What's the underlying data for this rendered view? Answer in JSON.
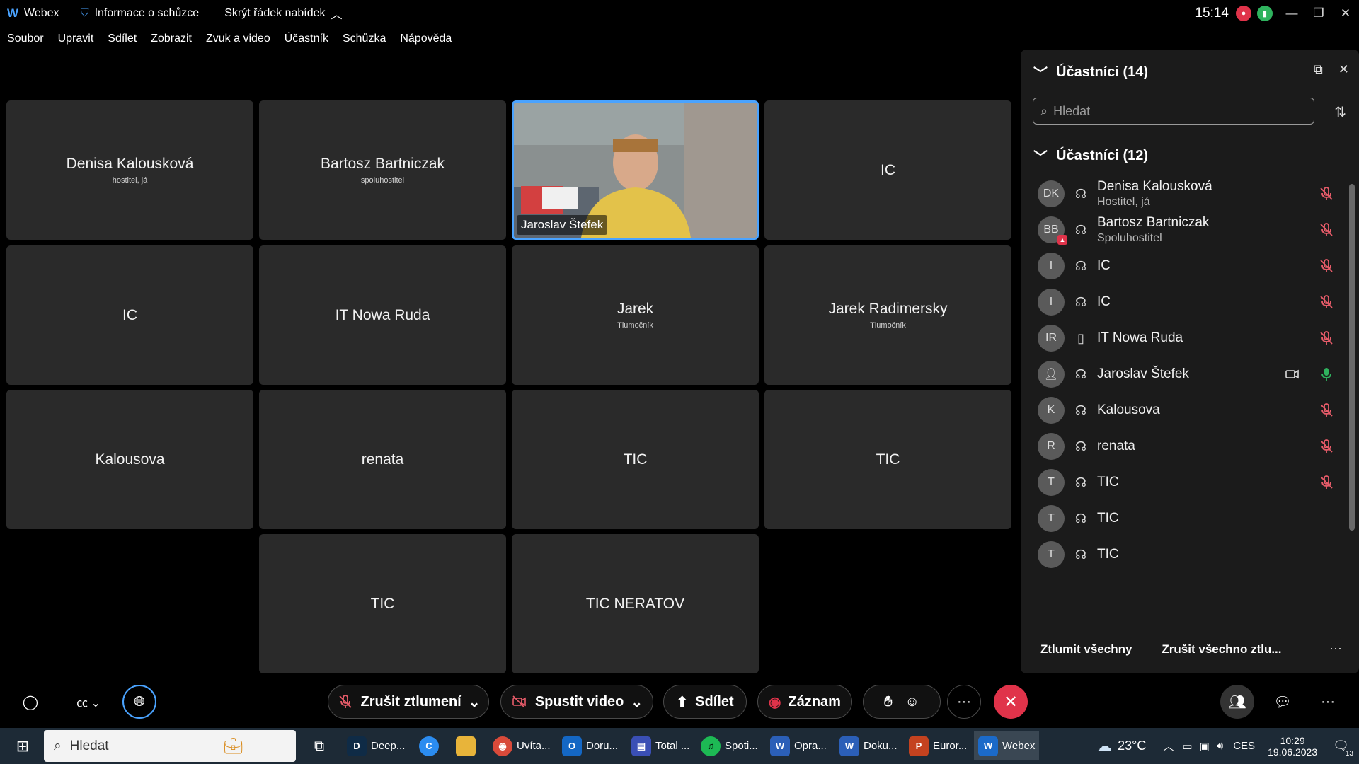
{
  "titlebar": {
    "app_name": "Webex",
    "meeting_info": "Informace o schůzce",
    "hide_menu": "Skrýt řádek nabídek",
    "time": "15:14"
  },
  "menu": [
    "Soubor",
    "Upravit",
    "Sdílet",
    "Zobrazit",
    "Zvuk a video",
    "Účastník",
    "Schůzka",
    "Nápověda"
  ],
  "tiles": [
    {
      "name": "Denisa Kalousková",
      "role": "hostitel, já"
    },
    {
      "name": "Bartosz Bartniczak",
      "role": "spoluhostitel"
    },
    {
      "name": "Jaroslav Štefek",
      "role": ""
    },
    {
      "name": "IC",
      "role": ""
    },
    {
      "name": "IC",
      "role": ""
    },
    {
      "name": "IT Nowa Ruda",
      "role": ""
    },
    {
      "name": "Jarek",
      "role": "Tlumočník"
    },
    {
      "name": "Jarek Radimersky",
      "role": "Tlumočník"
    },
    {
      "name": "Kalousova",
      "role": ""
    },
    {
      "name": "renata",
      "role": ""
    },
    {
      "name": "TIC",
      "role": ""
    },
    {
      "name": "TIC",
      "role": ""
    },
    {
      "name": "TIC",
      "role": ""
    },
    {
      "name": "TIC NERATOV",
      "role": ""
    }
  ],
  "panel": {
    "title": "Účastníci (14)",
    "search_placeholder": "Hledat",
    "section_title": "Účastníci (12)",
    "participants": [
      {
        "initials": "DK",
        "name": "Denisa Kalousková",
        "role": "Hostitel, já",
        "mic": "muted"
      },
      {
        "initials": "BB",
        "name": "Bartosz Bartniczak",
        "role": "Spoluhostitel",
        "mic": "muted"
      },
      {
        "initials": "I",
        "name": "IC",
        "role": "",
        "mic": "muted"
      },
      {
        "initials": "I",
        "name": "IC",
        "role": "",
        "mic": "muted"
      },
      {
        "initials": "IR",
        "name": "IT Nowa Ruda",
        "role": "",
        "mic": "muted"
      },
      {
        "initials": "",
        "name": "Jaroslav Štefek",
        "role": "",
        "mic": "on"
      },
      {
        "initials": "K",
        "name": "Kalousova",
        "role": "",
        "mic": "muted"
      },
      {
        "initials": "R",
        "name": "renata",
        "role": "",
        "mic": "muted"
      },
      {
        "initials": "T",
        "name": "TIC",
        "role": "",
        "mic": "muted"
      },
      {
        "initials": "T",
        "name": "TIC",
        "role": "",
        "mic": ""
      },
      {
        "initials": "T",
        "name": "TIC",
        "role": "",
        "mic": ""
      }
    ],
    "mute_all": "Ztlumit všechny",
    "unmute_all": "Zrušit všechno ztlu..."
  },
  "controls": {
    "unmute": "Zrušit ztlumení",
    "start_video": "Spustit video",
    "share": "Sdílet",
    "record": "Záznam"
  },
  "taskbar": {
    "search": "Hledat",
    "apps": [
      {
        "label": "Deep...",
        "icon": "deepl-icon",
        "color": "#0f2b46",
        "glyph": "D"
      },
      {
        "label": "",
        "icon": "canva-icon",
        "color": "#2b8cf0",
        "glyph": "C"
      },
      {
        "label": "",
        "icon": "folder-icon",
        "color": "#e8b43a",
        "glyph": "▬"
      },
      {
        "label": "Uvíta...",
        "icon": "chrome-icon",
        "color": "#d94a3a",
        "glyph": "◉"
      },
      {
        "label": "Doru...",
        "icon": "outlook-icon",
        "color": "#1467c4",
        "glyph": "O"
      },
      {
        "label": "Total ...",
        "icon": "total-commander-icon",
        "color": "#3a4fb5",
        "glyph": "▤"
      },
      {
        "label": "Spoti...",
        "icon": "spotify-icon",
        "color": "#1db954",
        "glyph": "♫"
      },
      {
        "label": "Opra...",
        "icon": "word-icon",
        "color": "#2b5fb8",
        "glyph": "W"
      },
      {
        "label": "Doku...",
        "icon": "word-icon",
        "color": "#2b5fb8",
        "glyph": "W"
      },
      {
        "label": "Euror...",
        "icon": "powerpoint-icon",
        "color": "#c4421f",
        "glyph": "P"
      },
      {
        "label": "Webex",
        "icon": "webex-icon",
        "color": "#1b6ac9",
        "glyph": "W"
      }
    ],
    "weather": "23°C",
    "lang": "CES",
    "time": "10:29",
    "date": "19.06.2023",
    "notifications": "13"
  },
  "colors": {
    "accent_blue": "#4aa3ff",
    "end_call": "#e0334a",
    "muted_red": "#e85c6a",
    "mic_green": "#2fb35e"
  }
}
